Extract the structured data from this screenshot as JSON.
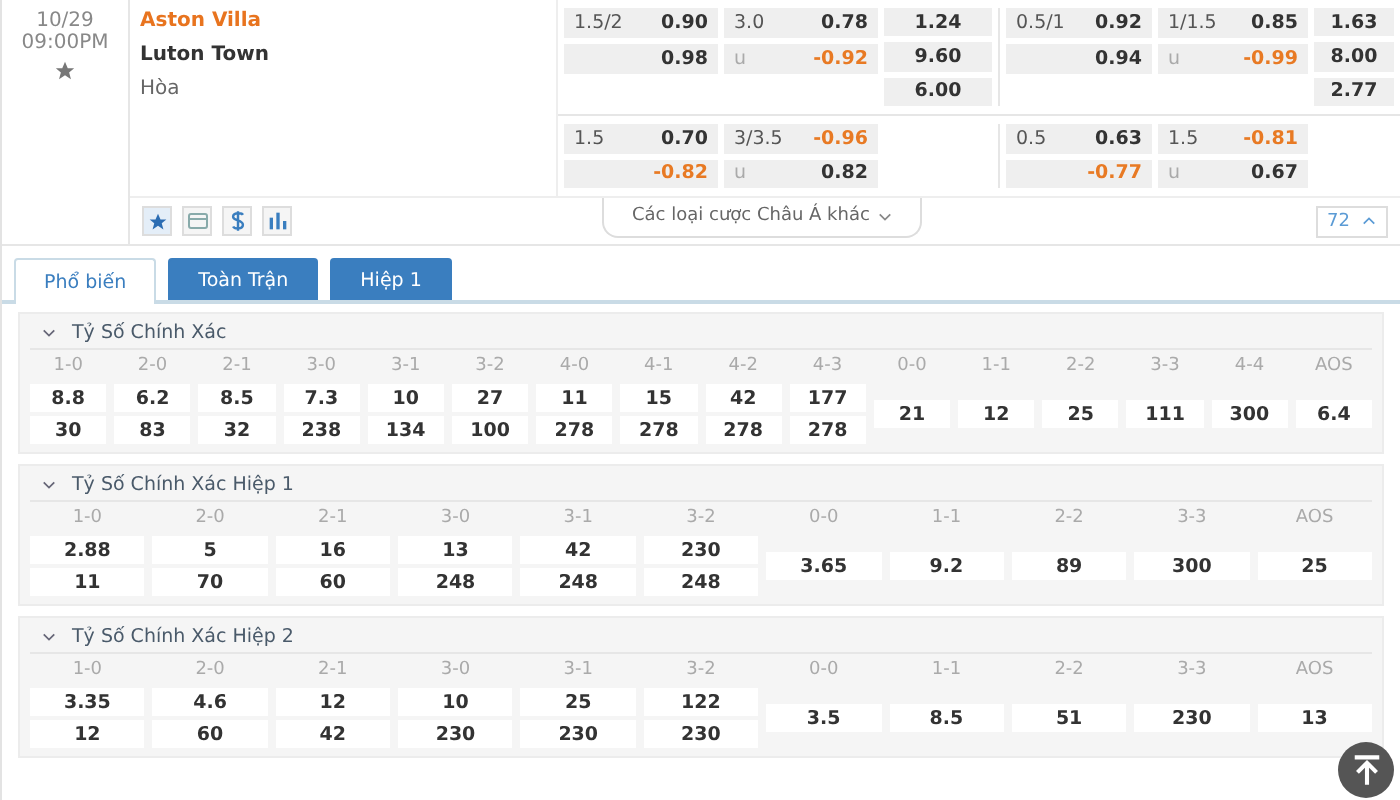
{
  "match": {
    "date": "10/29",
    "time": "09:00PM",
    "favorite": false,
    "home": "Aston Villa",
    "away": "Luton Town",
    "draw": "Hòa"
  },
  "odds_lines": [
    {
      "groups": [
        {
          "handicap": {
            "line": "1.5/2",
            "top": {
              "value": "0.90",
              "negative": false
            },
            "bottom": {
              "value": "0.98",
              "negative": false
            }
          },
          "over_under": {
            "line": "3.0",
            "under_label": "u",
            "top": {
              "value": "0.78",
              "negative": false
            },
            "bottom": {
              "value": "-0.92",
              "negative": true
            }
          },
          "result": [
            "1.24",
            "9.60",
            "6.00"
          ]
        },
        {
          "handicap": {
            "line": "0.5/1",
            "top": {
              "value": "0.92",
              "negative": false
            },
            "bottom": {
              "value": "0.94",
              "negative": false
            }
          },
          "over_under": {
            "line": "1/1.5",
            "under_label": "u",
            "top": {
              "value": "0.85",
              "negative": false
            },
            "bottom": {
              "value": "-0.99",
              "negative": true
            }
          },
          "result": [
            "1.63",
            "8.00",
            "2.77"
          ]
        }
      ]
    },
    {
      "groups": [
        {
          "handicap": {
            "line": "1.5",
            "top": {
              "value": "0.70",
              "negative": false
            },
            "bottom": {
              "value": "-0.82",
              "negative": true
            }
          },
          "over_under": {
            "line": "3/3.5",
            "under_label": "u",
            "top": {
              "value": "-0.96",
              "negative": true
            },
            "bottom": {
              "value": "0.82",
              "negative": false
            }
          }
        },
        {
          "handicap": {
            "line": "0.5",
            "top": {
              "value": "0.63",
              "negative": false
            },
            "bottom": {
              "value": "-0.77",
              "negative": true
            }
          },
          "over_under": {
            "line": "1.5",
            "under_label": "u",
            "top": {
              "value": "-0.81",
              "negative": true
            },
            "bottom": {
              "value": "0.67",
              "negative": false
            }
          }
        }
      ]
    }
  ],
  "toolbar": {
    "tools": [
      {
        "kind": "star",
        "selected": true
      },
      {
        "kind": "card",
        "selected": false
      },
      {
        "kind": "dollar",
        "selected": false
      },
      {
        "kind": "chart",
        "selected": false
      }
    ],
    "more_markets": "Các loại cược Châu Á khác",
    "count": "72"
  },
  "tabs": [
    {
      "label": "Phổ biến",
      "selected": true
    },
    {
      "label": "Toàn Trận",
      "selected": false
    },
    {
      "label": "Hiệp 1",
      "selected": false
    }
  ],
  "sections": [
    {
      "title": "Tỷ Số Chính Xác",
      "expanded": true,
      "columns": [
        {
          "label": "1-0",
          "values": [
            "8.8",
            "30"
          ]
        },
        {
          "label": "2-0",
          "values": [
            "6.2",
            "83"
          ]
        },
        {
          "label": "2-1",
          "values": [
            "8.5",
            "32"
          ]
        },
        {
          "label": "3-0",
          "values": [
            "7.3",
            "238"
          ]
        },
        {
          "label": "3-1",
          "values": [
            "10",
            "134"
          ]
        },
        {
          "label": "3-2",
          "values": [
            "27",
            "100"
          ]
        },
        {
          "label": "4-0",
          "values": [
            "11",
            "278"
          ]
        },
        {
          "label": "4-1",
          "values": [
            "15",
            "278"
          ]
        },
        {
          "label": "4-2",
          "values": [
            "42",
            "278"
          ]
        },
        {
          "label": "4-3",
          "values": [
            "177",
            "278"
          ]
        },
        {
          "label": "0-0",
          "values": [
            "21"
          ]
        },
        {
          "label": "1-1",
          "values": [
            "12"
          ]
        },
        {
          "label": "2-2",
          "values": [
            "25"
          ]
        },
        {
          "label": "3-3",
          "values": [
            "111"
          ]
        },
        {
          "label": "4-4",
          "values": [
            "300"
          ]
        },
        {
          "label": "AOS",
          "values": [
            "6.4"
          ]
        }
      ]
    },
    {
      "title": "Tỷ Số Chính Xác Hiệp 1",
      "expanded": true,
      "columns": [
        {
          "label": "1-0",
          "values": [
            "2.88",
            "11"
          ]
        },
        {
          "label": "2-0",
          "values": [
            "5",
            "70"
          ]
        },
        {
          "label": "2-1",
          "values": [
            "16",
            "60"
          ]
        },
        {
          "label": "3-0",
          "values": [
            "13",
            "248"
          ]
        },
        {
          "label": "3-1",
          "values": [
            "42",
            "248"
          ]
        },
        {
          "label": "3-2",
          "values": [
            "230",
            "248"
          ]
        },
        {
          "label": "0-0",
          "values": [
            "3.65"
          ]
        },
        {
          "label": "1-1",
          "values": [
            "9.2"
          ]
        },
        {
          "label": "2-2",
          "values": [
            "89"
          ]
        },
        {
          "label": "3-3",
          "values": [
            "300"
          ]
        },
        {
          "label": "AOS",
          "values": [
            "25"
          ]
        }
      ]
    },
    {
      "title": "Tỷ Số Chính Xác Hiệp 2",
      "expanded": true,
      "columns": [
        {
          "label": "1-0",
          "values": [
            "3.35",
            "12"
          ]
        },
        {
          "label": "2-0",
          "values": [
            "4.6",
            "60"
          ]
        },
        {
          "label": "2-1",
          "values": [
            "12",
            "42"
          ]
        },
        {
          "label": "3-0",
          "values": [
            "10",
            "230"
          ]
        },
        {
          "label": "3-1",
          "values": [
            "25",
            "230"
          ]
        },
        {
          "label": "3-2",
          "values": [
            "122",
            "230"
          ]
        },
        {
          "label": "0-0",
          "values": [
            "3.5"
          ]
        },
        {
          "label": "1-1",
          "values": [
            "8.5"
          ]
        },
        {
          "label": "2-2",
          "values": [
            "51"
          ]
        },
        {
          "label": "3-3",
          "values": [
            "230"
          ]
        },
        {
          "label": "AOS",
          "values": [
            "13"
          ]
        }
      ]
    }
  ]
}
